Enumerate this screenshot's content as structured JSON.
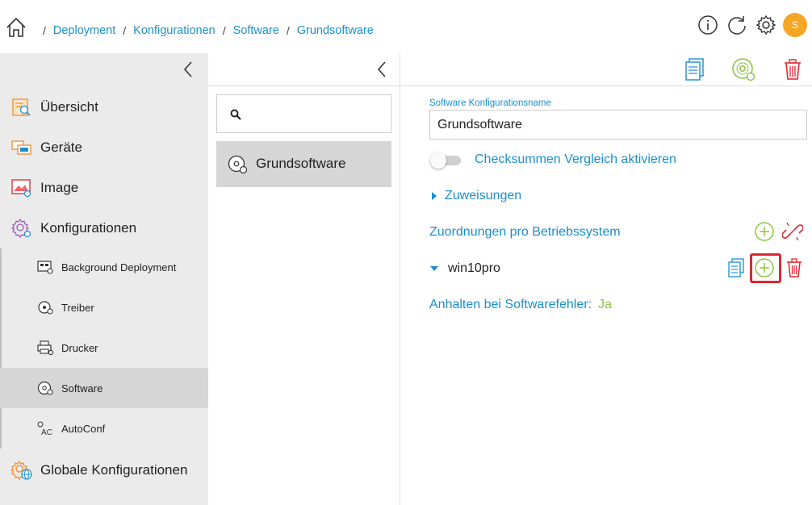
{
  "breadcrumb": {
    "items": [
      {
        "label": "Deployment"
      },
      {
        "label": "Konfigurationen"
      },
      {
        "label": "Software"
      },
      {
        "label": "Grundsoftware"
      }
    ],
    "separator": "/"
  },
  "user": {
    "avatar_initial": "S",
    "avatar_color": "#f5a623"
  },
  "sidebar": {
    "items": [
      {
        "label": "Übersicht",
        "icon": "overview-icon"
      },
      {
        "label": "Geräte",
        "icon": "devices-icon"
      },
      {
        "label": "Image",
        "icon": "image-icon"
      },
      {
        "label": "Konfigurationen",
        "icon": "configurations-icon"
      },
      {
        "label": "Globale Konfigurationen",
        "icon": "globe-config-icon"
      }
    ],
    "sub_items": [
      {
        "label": "Background Deployment",
        "icon": "background-deployment-icon"
      },
      {
        "label": "Treiber",
        "icon": "driver-icon"
      },
      {
        "label": "Drucker",
        "icon": "printer-icon"
      },
      {
        "label": "Software",
        "icon": "software-disc-icon",
        "active": true
      },
      {
        "label": "AutoConf",
        "icon": "autoconf-icon"
      }
    ]
  },
  "middle": {
    "search": {
      "placeholder": "",
      "value": ""
    },
    "list": [
      {
        "label": "Grundsoftware",
        "selected": true
      }
    ]
  },
  "detail": {
    "name_label": "Software Konfigurationsname",
    "name_value": "Grundsoftware",
    "checksum_toggle": {
      "label": "Checksummen Vergleich aktivieren",
      "on": false
    },
    "assignments_label": "Zuweisungen",
    "os_mappings_label": "Zuordnungen pro Betriebssystem",
    "os_entry": "win10pro",
    "halt_label": "Anhalten bei Softwarefehler:",
    "halt_value": "Ja"
  },
  "colors": {
    "link": "#1a8fcf",
    "success": "#8cc63f",
    "danger": "#e0262f",
    "sidebar_bg": "#ebebeb",
    "active_bg": "#d6d6d6"
  }
}
